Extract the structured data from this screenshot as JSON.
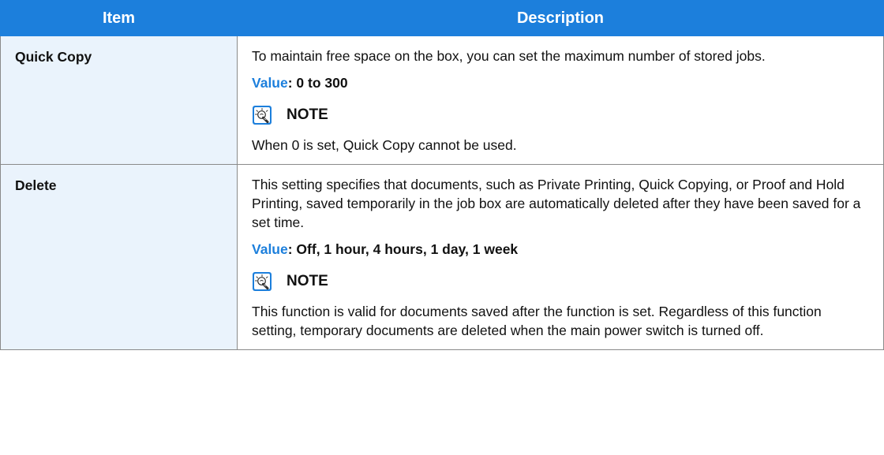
{
  "table": {
    "headers": {
      "item": "Item",
      "description": "Description"
    },
    "rows": [
      {
        "item": "Quick Copy",
        "description": "To maintain free space on the box, you can set the maximum number of stored jobs.",
        "value_label": "Value",
        "value_text": ": 0 to 300",
        "note_label": "NOTE",
        "note_text": "When 0 is set, Quick Copy cannot be used.",
        "note_icon": "note-lightbulb-icon"
      },
      {
        "item": "Delete",
        "description": "This setting specifies that documents, such as Private Printing, Quick Copying, or Proof and Hold Printing, saved temporarily in the job box are automatically deleted after they have been saved for a set time.",
        "value_label": "Value",
        "value_text": ": Off, 1 hour, 4 hours, 1 day, 1 week",
        "note_label": "NOTE",
        "note_text": "This function is valid for documents saved after the function is set. Regardless of this function setting, temporary documents are deleted when the main power switch is turned off.",
        "note_icon": "note-lightbulb-icon"
      }
    ]
  },
  "colors": {
    "header_background": "#1c7fdc",
    "header_text": "#ffffff",
    "item_column_background": "#eaf3fc",
    "value_label": "#1c7fdc",
    "border": "#8a8a8a"
  }
}
